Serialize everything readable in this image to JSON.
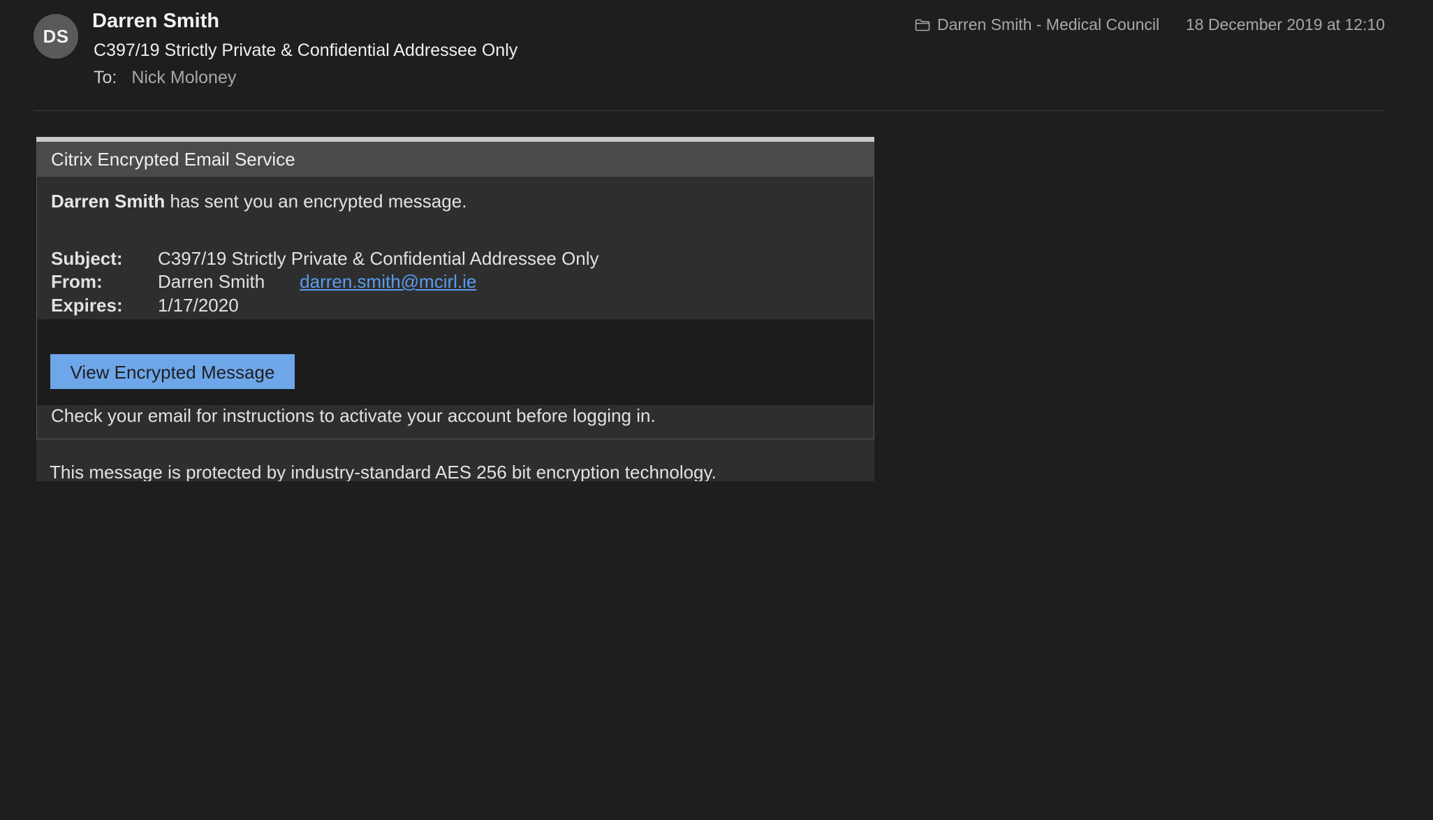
{
  "message": {
    "avatar_initials": "DS",
    "sender_name": "Darren Smith",
    "subject": "C397/19 Strictly Private & Confidential Addressee Only",
    "to_label": "To:",
    "to_value": "Nick Moloney",
    "folder": "Darren Smith - Medical Council",
    "date": "18 December 2019 at 12:10",
    "folder_icon": "folder-icon"
  },
  "card": {
    "title": "Citrix Encrypted Email Service",
    "intro_name": "Darren Smith",
    "intro_rest": " has sent you an encrypted message.",
    "subject_label": "Subject:",
    "subject_value": "C397/19 Strictly Private & Confidential Addressee Only",
    "from_label": "From:",
    "from_name": "Darren Smith",
    "from_email": "darren.smith@mcirl.ie",
    "expires_label": "Expires:",
    "expires_value": "1/17/2020",
    "button_label": "View Encrypted Message",
    "check_text": "Check your email for instructions to activate your account before logging in.",
    "footer_text": "This message is protected by industry-standard AES 256 bit encryption technology.",
    "button_color": "#6ea6ea",
    "link_color": "#5a9cf0"
  }
}
